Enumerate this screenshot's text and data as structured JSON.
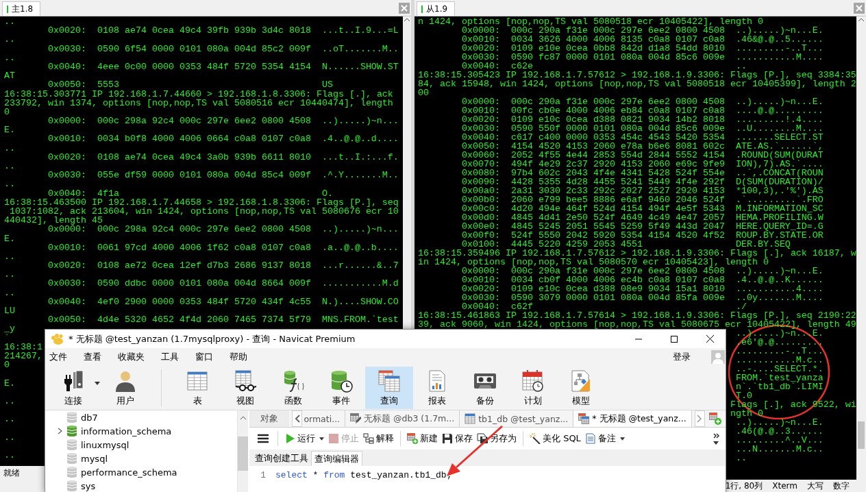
{
  "terminals": [
    {
      "tab": "主1.8",
      "status": [
        "就绪"
      ],
      "lines": [
        "..",
        {
          "kind": "hex",
          "dump": "0x0020:  0108 ae74 0cea 49c4 39fb 939b 3d4c 8018",
          "ascii": "...t..I.9...=L"
        },
        "..",
        {
          "kind": "hex",
          "dump": "0x0030:  0590 6f54 0000 0101 080a 004d 85c2 009f",
          "ascii": "..oT.......M.."
        },
        "..",
        {
          "kind": "hex",
          "dump": "0x0040:  4eee 0c00 0000 0353 484f 5720 5354 4154",
          "ascii": "N......SHOW.ST"
        },
        "AT",
        {
          "kind": "hex",
          "dump": "0x0050:  5553",
          "ascii": "US"
        },
        "16:38:15.303771 IP 192.168.1.7.44660 > 192.168.1.8.3306: Flags [.], ack",
        "233792, win 1374, options [nop,nop,TS val 5080516 ecr 10440474], length",
        "0",
        {
          "kind": "hex",
          "dump": "0x0000:  000c 298a 92c4 000c 297e 6ee2 0800 4508",
          "ascii": "..).....)~n..."
        },
        "E.",
        {
          "kind": "hex",
          "dump": "0x0010:  0034 b0f8 4000 4006 0664 c0a8 0107 c0a8",
          "ascii": ".4..@.@..d...."
        },
        "..",
        {
          "kind": "hex",
          "dump": "0x0020:  0108 ae74 0cea 49c4 3a0b 939b 6611 8010",
          "ascii": "...t..I.:...f."
        },
        "..",
        {
          "kind": "hex",
          "dump": "0x0030:  055e df59 0000 0101 080a 004d 85c4 009f",
          "ascii": ".^.Y.......M.."
        },
        "..",
        {
          "kind": "hex",
          "dump": "0x0040:  4f1a",
          "ascii": "O."
        },
        "16:38:15.463500 IP 192.168.1.7.44658 > 192.168.1.8.3306: Flags [P.], seq",
        " 1037:1082, ack 213604, win 1424, options [nop,nop,TS val 5080676 ecr 10",
        "440432], length 45",
        {
          "kind": "hex",
          "dump": "0x0000:  000c 298a 92c4 000c 297e 6ee2 0800 4508",
          "ascii": "..).....)~n..."
        },
        "E.",
        {
          "kind": "hex",
          "dump": "0x0010:  0061 97cd 4000 4006 1f62 c0a8 0107 c0a8",
          "ascii": ".a..@.@..b...."
        },
        "..",
        {
          "kind": "hex",
          "dump": "0x0020:  0108 ae72 0cea 12ef d7b3 2686 9137 8018",
          "ascii": "...r......&..7"
        },
        "..",
        {
          "kind": "hex",
          "dump": "0x0030:  0590 ddbc 0000 0101 080a 004d 8664 009f",
          "ascii": "...........M.d"
        },
        "..",
        {
          "kind": "hex",
          "dump": "0x0040:  4ef0 2900 0000 0353 484f 5720 434f 4c55",
          "ascii": "N.)....SHOW.CO"
        },
        "LU",
        {
          "kind": "hex",
          "dump": "0x0050:  4d4e 5320 4652 4f4d 2060 7465 7374 5f79",
          "ascii": "MNS.FROM.`test"
        },
        "_y",
        "`",
        "16:38:1",
        "214267,",
        "0",
        {
          "kind": "covered"
        },
        "E.",
        {
          "kind": "covered"
        },
        "..",
        {
          "kind": "covered"
        },
        "..",
        {
          "kind": "covered"
        },
        "..",
        {
          "kind": "covered"
        },
        ".."
      ]
    },
    {
      "tab": "从1.9",
      "status": [
        "1行, 80列",
        "Xterm",
        "大写",
        "数字"
      ],
      "lines": [
        "n 1424, options [nop,nop,TS val 5080518 ecr 10405422], length 0",
        {
          "kind": "hex",
          "dump": "0x0000:  000c 290a f31e 000c 297e 6ee2 0800 4508",
          "ascii": "..).....)~n...E."
        },
        {
          "kind": "hex",
          "dump": "0x0010:  0034 3626 4000 4006 8135 c0a8 0107 c0a8",
          "ascii": ".46&@.@..5......"
        },
        {
          "kind": "hex",
          "dump": "0x0020:  0109 e10e 0cea 0bb8 842d d1a8 54dd 8010",
          "ascii": ".........-..T..."
        },
        {
          "kind": "hex",
          "dump": "0x0030:  0590 fc87 0000 0101 080a 004d 85c6 009e",
          "ascii": "...........M...."
        },
        {
          "kind": "hex",
          "dump": "0x0040:  c62e",
          "ascii": ".."
        },
        "16:38:15.305423 IP 192.168.1.7.57612 > 192.168.1.9.3306: Flags [P.], seq 3384:35",
        "84, ack 15948, win 1424, options [nop,nop,TS val 5080518 ecr 10405399], length 2",
        "00",
        {
          "kind": "hex",
          "dump": "0x0000:  000c 290a f31e 000c 297e 6ee2 0800 4508",
          "ascii": "..).....)~n...E."
        },
        {
          "kind": "hex",
          "dump": "0x0010:  00fc cb0e 4000 4006 eb84 c0a8 0107 c0a8",
          "ascii": "....@.@........."
        },
        {
          "kind": "hex",
          "dump": "0x0020:  0109 e10c 0cea d388 0821 9034 14b2 8018",
          "ascii": ".........!.4...."
        },
        {
          "kind": "hex",
          "dump": "0x0030:  0590 550f 0000 0101 080a 004d 85c6 009e",
          "ascii": "..U........M...."
        },
        {
          "kind": "hex",
          "dump": "0x0040:  c617 c400 0000 0353 454c 4543 5420 5354",
          "ascii": ".......SELECT.ST"
        },
        {
          "kind": "hex",
          "dump": "0x0050:  4154 4520 4153 2060 e78a b6e6 8081 602c",
          "ascii": "ATE.AS.`......`,"
        },
        {
          "kind": "hex",
          "dump": "0x0060:  2052 4f55 4e44 2853 554d 2844 5552 4154",
          "ascii": ".ROUND(SUM(DURAT"
        },
        {
          "kind": "hex",
          "dump": "0x0070:  494f 4e29 2c37 2920 4153 2060 e69c 9fe9",
          "ascii": "ION),7).AS.`...."
        },
        {
          "kind": "hex",
          "dump": "0x0080:  97b4 602c 2043 4f4e 4341 5428 524f 554e",
          "ascii": "..`,.CONCAT(ROUN"
        },
        {
          "kind": "hex",
          "dump": "0x0090:  4428 5355 4d28 4455 5241 5449 4f4e 292f",
          "ascii": "D(SUM(DURATION)/"
        },
        {
          "kind": "hex",
          "dump": "0x00a0:  2a31 3030 2c33 292c 2027 2527 2920 4153",
          "ascii": "*100,3),.'%').AS"
        },
        {
          "kind": "hex",
          "dump": "0x00b0:  2060 e799 bee5 8886 e6af 9460 2046 524f",
          "ascii": ".`.........`.FRO"
        },
        {
          "kind": "hex",
          "dump": "0x00c0:  4d20 494e 464f 524d 4154 494f 4e5f 5343",
          "ascii": "M.INFORMATION_SC"
        },
        {
          "kind": "hex",
          "dump": "0x00d0:  4845 4d41 2e50 524f 4649 4c49 4e47 2057",
          "ascii": "HEMA.PROFILING.W"
        },
        {
          "kind": "hex",
          "dump": "0x00e0:  4845 5245 2051 5545 5259 5f49 443d 2047",
          "ascii": "HERE.QUERY_ID=.G"
        },
        {
          "kind": "hex",
          "dump": "0x00f0:  524f 5550 2042 5920 5354 4154 4520 4f52",
          "ascii": "ROUP.BY.STATE.OR"
        },
        {
          "kind": "hex",
          "dump": "0x0100:  4445 5220 4259 2053 4551",
          "ascii": "DER.BY.SEQ"
        },
        "16:38:15.359496 IP 192.168.1.7.57612 > 192.168.1.9.3306: Flags [.], ack 16187, w",
        "in 1424, options [nop,nop,TS val 5080570 ecr 10405423], length 0",
        {
          "kind": "hex",
          "dump": "0x0000:  000c 290a f31e 000c 297e 6ee2 0800 4508",
          "ascii": "..).....)~n...E."
        },
        {
          "kind": "hex",
          "dump": "0x0010:  0034 cb0f 4000 4006 ec4b c0a8 0107 c0a8",
          "ascii": ".4..@.@..K......"
        },
        {
          "kind": "hex",
          "dump": "0x0020:  0109 e10c 0cea d388 08e9 9034 15a1 8010",
          "ascii": "...........4...."
        },
        {
          "kind": "hex",
          "dump": "0x0030:  0590 3079 0000 0101 080a 004d 85fa 009e",
          "ascii": "..0y.......M...."
        },
        {
          "kind": "hex",
          "dump": "0x0040:  c62f",
          "ascii": "./"
        },
        "16:38:15.461863 IP 192.168.1.7.57614 > 192.168.1.9.3306: Flags [P.], seq 2190:22",
        "39, ack 9060, win 1424, options [nop,nop,TS val 5080675 ecr 10405422], length 49",
        {
          "kind": "hex",
          "ascii": "..).....)~n...E."
        },
        {
          "kind": "hex",
          "ascii": ".e6'@.@........."
        },
        {
          "kind": "hex",
          "ascii": ".........-..T..."
        },
        {
          "kind": "hex",
          "ascii": "...........M.c.."
        },
        {
          "kind": "hex",
          "ascii": "..-....SELECT.*."
        },
        {
          "kind": "hex",
          "ascii": "FROM.`test_yanza"
        },
        {
          "kind": "hex",
          "ascii": "n`.`tb1_db`.LIMI"
        },
        {
          "kind": "hex",
          "ascii": "T.0"
        },
        {
          "kind": "tail",
          "text": "Flags [.], ack 9522, wi"
        },
        {
          "kind": "tail",
          "text": "ngth 0"
        },
        {
          "kind": "hex",
          "ascii": "..).....)~n...E."
        },
        {
          "kind": "hex",
          "ascii": ".46(@.@..3......"
        },
        {
          "kind": "hex",
          "ascii": ".........^..V..."
        },
        {
          "kind": "hex",
          "ascii": "...N.......M.c.."
        },
        {
          "kind": "hex",
          "ascii": ".."
        }
      ]
    }
  ],
  "navicat": {
    "title": "* 无标题 @test_yanzan (1.7mysqlproxy) - 查询 - Navicat Premium",
    "menu": [
      "文件",
      "查看",
      "收藏夹",
      "工具",
      "窗口",
      "帮助"
    ],
    "login": "登录",
    "toolbar": [
      [
        {
          "label": "连接",
          "kind": "connection",
          "selected": false,
          "dropdown": true
        },
        {
          "label": "用户",
          "kind": "user",
          "selected": false,
          "dropdown": false
        }
      ],
      [
        {
          "label": "表",
          "kind": "table",
          "selected": false,
          "dropdown": false
        },
        {
          "label": "视图",
          "kind": "view",
          "selected": false,
          "dropdown": false
        },
        {
          "label": "函数",
          "kind": "function",
          "selected": false,
          "dropdown": false
        },
        {
          "label": "事件",
          "kind": "event",
          "selected": false,
          "dropdown": false
        },
        {
          "label": "查询",
          "kind": "query",
          "selected": true,
          "dropdown": false
        },
        {
          "label": "报表",
          "kind": "report",
          "selected": false,
          "dropdown": false
        },
        {
          "label": "备份",
          "kind": "backup",
          "selected": false,
          "dropdown": false
        },
        {
          "label": "计划",
          "kind": "schedule",
          "selected": false,
          "dropdown": false
        },
        {
          "label": "模型",
          "kind": "model",
          "selected": false,
          "dropdown": false
        }
      ]
    ],
    "tree": [
      {
        "label": "db7",
        "expandable": false,
        "open": false
      },
      {
        "label": "information_schema",
        "expandable": true,
        "open": true
      },
      {
        "label": "linuxmysql",
        "expandable": false,
        "open": false
      },
      {
        "label": "mysql",
        "expandable": false,
        "open": false
      },
      {
        "label": "performance_schema",
        "expandable": false,
        "open": false
      },
      {
        "label": "sys",
        "expandable": false,
        "open": false
      }
    ],
    "objects_tab": "对象",
    "tabs": [
      {
        "label": "ormati...",
        "kind": "plain",
        "selected": false
      },
      {
        "label": "无标题 @db3 (1.7m...",
        "kind": "query-design",
        "selected": false
      },
      {
        "label": "tb1_db @test_yanz...",
        "kind": "table",
        "selected": false
      },
      {
        "label": "* 无标题 @test_yanz...",
        "kind": "query",
        "selected": true
      }
    ],
    "query_toolbar": [
      {
        "kind": "menu"
      },
      {
        "kind": "separator"
      },
      {
        "kind": "run",
        "label": "运行",
        "dropdown": true,
        "disabled": false
      },
      {
        "kind": "stop",
        "label": "停止",
        "dropdown": false,
        "disabled": true
      },
      {
        "kind": "explain",
        "label": "解释",
        "dropdown": false,
        "disabled": false
      },
      {
        "kind": "separator"
      },
      {
        "kind": "new",
        "label": "新建",
        "dropdown": false,
        "disabled": false
      },
      {
        "kind": "save",
        "label": "保存",
        "dropdown": false,
        "disabled": false
      },
      {
        "kind": "save-as",
        "label": "另存为",
        "dropdown": false,
        "disabled": false
      },
      {
        "kind": "separator"
      },
      {
        "kind": "beautify",
        "label": "美化 SQL",
        "dropdown": false,
        "disabled": false
      },
      {
        "kind": "memo",
        "label": "备注",
        "dropdown": true,
        "disabled": false
      },
      {
        "kind": "overflow"
      }
    ],
    "subtabs": [
      {
        "label": "查询创建工具",
        "selected": false
      },
      {
        "label": "查询编辑器",
        "selected": true
      }
    ],
    "editor": [
      {
        "number": "1",
        "tokens": [
          {
            "text": "select",
            "kind": "keyword"
          },
          {
            "text": " * ",
            "kind": "plain"
          },
          {
            "text": "from",
            "kind": "keyword"
          },
          {
            "text": " test_yanzan.tb1_db;",
            "kind": "plain"
          }
        ]
      }
    ]
  }
}
